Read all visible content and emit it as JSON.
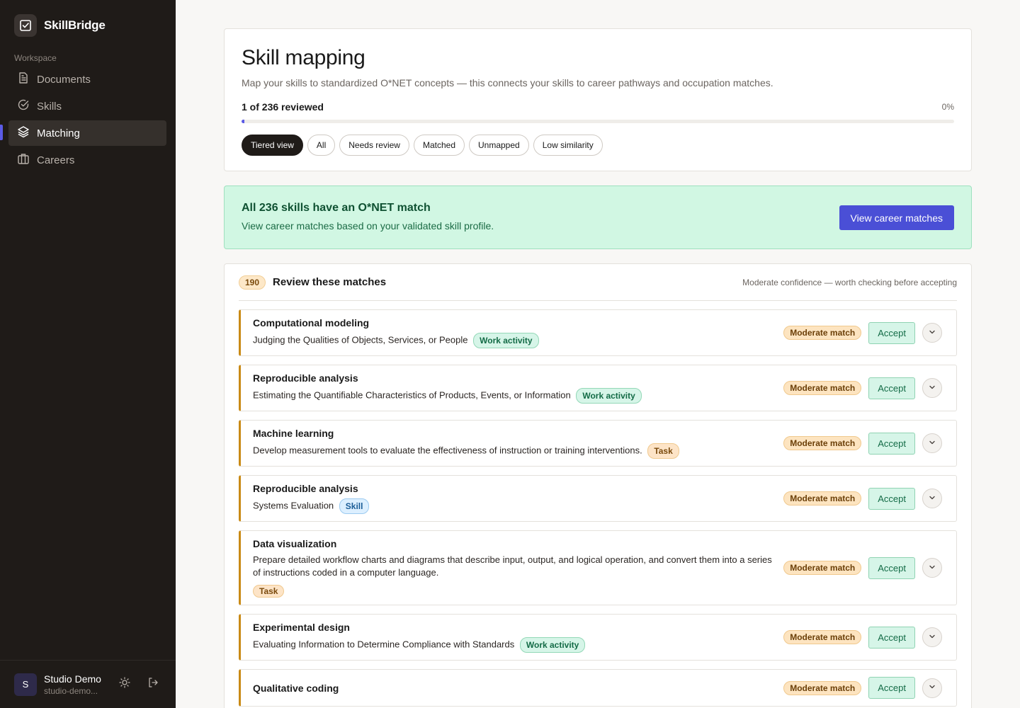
{
  "app": {
    "name": "SkillBridge"
  },
  "sidebar": {
    "section_label": "Workspace",
    "items": [
      {
        "label": "Documents",
        "icon": "document-icon",
        "active": false
      },
      {
        "label": "Skills",
        "icon": "check-circle-icon",
        "active": false
      },
      {
        "label": "Matching",
        "icon": "layers-icon",
        "active": true
      },
      {
        "label": "Careers",
        "icon": "briefcase-icon",
        "active": false
      }
    ],
    "user": {
      "initial": "S",
      "name": "Studio Demo",
      "email": "studio-demo..."
    }
  },
  "header": {
    "title": "Skill mapping",
    "description": "Map your skills to standardized O*NET concepts — this connects your skills to career pathways and occupation matches.",
    "progress_label": "1 of 236 reviewed",
    "progress_pct": "0%",
    "progress_value": 0.004,
    "filters": [
      "Tiered view",
      "All",
      "Needs review",
      "Matched",
      "Unmapped",
      "Low similarity"
    ],
    "active_filter": "Tiered view"
  },
  "banner": {
    "title": "All 236 skills have an O*NET match",
    "subtitle": "View career matches based on your validated skill profile.",
    "button": "View career matches"
  },
  "review": {
    "count": "190",
    "title": "Review these matches",
    "hint": "Moderate confidence — worth checking before accepting",
    "match_badge": "Moderate match",
    "accept_label": "Accept",
    "items": [
      {
        "title": "Computational modeling",
        "desc": "Judging the Qualities of Objects, Services, or People",
        "tag": "Work activity",
        "tag_type": "wa"
      },
      {
        "title": "Reproducible analysis",
        "desc": "Estimating the Quantifiable Characteristics of Products, Events, or Information",
        "tag": "Work activity",
        "tag_type": "wa"
      },
      {
        "title": "Machine learning",
        "desc": "Develop measurement tools to evaluate the effectiveness of instruction or training interventions.",
        "tag": "Task",
        "tag_type": "task"
      },
      {
        "title": "Reproducible analysis",
        "desc": "Systems Evaluation",
        "tag": "Skill",
        "tag_type": "skill"
      },
      {
        "title": "Data visualization",
        "desc": "Prepare detailed workflow charts and diagrams that describe input, output, and logical operation, and convert them into a series of instructions coded in a computer language.",
        "tag": "Task",
        "tag_type": "task"
      },
      {
        "title": "Experimental design",
        "desc": "Evaluating Information to Determine Compliance with Standards",
        "tag": "Work activity",
        "tag_type": "wa"
      },
      {
        "title": "Qualitative coding",
        "desc": "",
        "tag": "",
        "tag_type": ""
      }
    ]
  },
  "colors": {
    "accent": "#4a4fd6",
    "sidebar_bg": "#1f1b18",
    "banner_bg": "#d1f7e3",
    "moderate": "#c98a16"
  }
}
